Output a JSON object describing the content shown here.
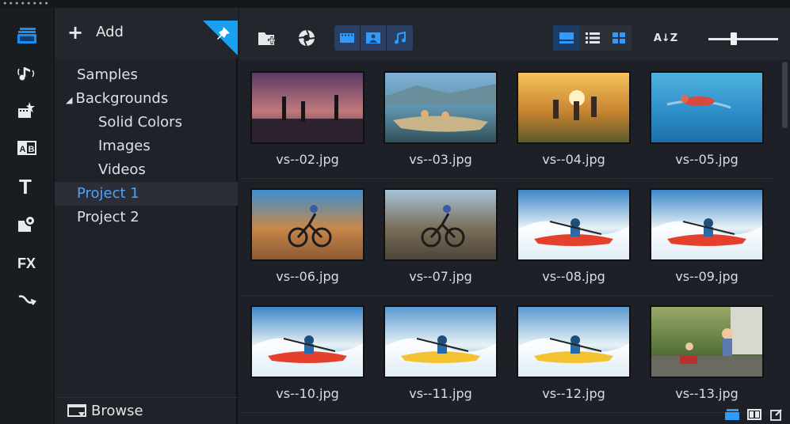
{
  "window": {
    "grip": "••••••••"
  },
  "library": {
    "add_label": "Add",
    "browse_label": "Browse",
    "tree": [
      {
        "label": "Samples",
        "level": 0,
        "expanded": false
      },
      {
        "label": "Backgrounds",
        "level": 0,
        "expanded": true
      },
      {
        "label": "Solid Colors",
        "level": 1
      },
      {
        "label": "Images",
        "level": 1
      },
      {
        "label": "Videos",
        "level": 1
      },
      {
        "label": "Project 1",
        "level": 0,
        "selected": true
      },
      {
        "label": "Project 2",
        "level": 0
      }
    ],
    "expand_arrow": "◢"
  },
  "sidebar_icons": [
    {
      "name": "media-library-icon",
      "active": true
    },
    {
      "name": "music-icon"
    },
    {
      "name": "instant-project-icon"
    },
    {
      "name": "transition-icon"
    },
    {
      "name": "title-icon"
    },
    {
      "name": "graphics-icon"
    },
    {
      "name": "filter-icon"
    },
    {
      "name": "path-icon"
    }
  ],
  "sidebar_labels": {
    "title": "T",
    "filter": "FX",
    "transition": "AB"
  },
  "toolbar": {
    "icons": [
      "import-folder-icon",
      "capture-icon",
      "show-video-icon",
      "show-photo-icon",
      "show-audio-icon",
      "thumbnail-view-icon",
      "list-view-icon",
      "grid-view-icon",
      "sort-icon"
    ],
    "sort_label": "A↓Z"
  },
  "zoom_slider": {
    "value": 0.36
  },
  "media": [
    {
      "name": "vs--02.jpg",
      "theme": "dusk-beach"
    },
    {
      "name": "vs--03.jpg",
      "theme": "boat-lake"
    },
    {
      "name": "vs--04.jpg",
      "theme": "sunset-field"
    },
    {
      "name": "vs--05.jpg",
      "theme": "swimmer-pool"
    },
    {
      "name": "vs--06.jpg",
      "theme": "desert-bike"
    },
    {
      "name": "vs--07.jpg",
      "theme": "rock-bike"
    },
    {
      "name": "vs--08.jpg",
      "theme": "kayak"
    },
    {
      "name": "vs--09.jpg",
      "theme": "kayak"
    },
    {
      "name": "vs--10.jpg",
      "theme": "kayak"
    },
    {
      "name": "vs--11.jpg",
      "theme": "kayak-yellow"
    },
    {
      "name": "vs--12.jpg",
      "theme": "kayak-yellow"
    },
    {
      "name": "vs--13.jpg",
      "theme": "kids-park"
    }
  ],
  "colors": {
    "accent": "#4ea1ff",
    "toggle_on": "#2a3f63",
    "panel": "#1f2228",
    "pin": "#1aa0f0"
  }
}
